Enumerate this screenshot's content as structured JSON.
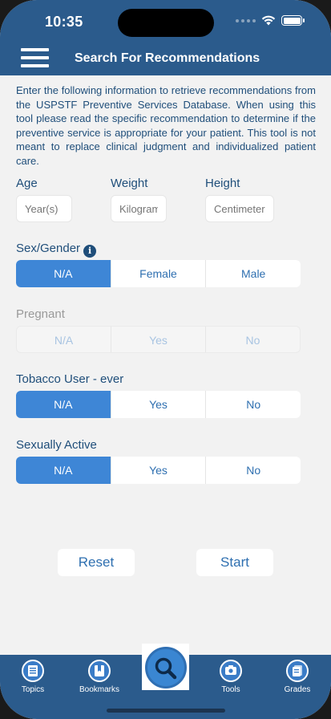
{
  "status": {
    "time": "10:35"
  },
  "header": {
    "title": "Search For Recommendations"
  },
  "intro": "Enter the following information to retrieve recommendations from the USPSTF Preventive Services Database. When using this tool please read the specific recommendation to determine if the  preventive service is appropriate for your patient. This tool is not meant to replace clinical judgment and individualized patient care.",
  "fields": {
    "age": {
      "label": "Age",
      "placeholder": "Year(s)"
    },
    "weight": {
      "label": "Weight",
      "placeholder": "Kilograms"
    },
    "height": {
      "label": "Height",
      "placeholder": "Centimeters"
    }
  },
  "sex": {
    "label": "Sex/Gender",
    "options": [
      "N/A",
      "Female",
      "Male"
    ],
    "selected": "N/A"
  },
  "pregnant": {
    "label": "Pregnant",
    "options": [
      "N/A",
      "Yes",
      "No"
    ],
    "disabled": true
  },
  "tobacco": {
    "label": "Tobacco User - ever",
    "options": [
      "N/A",
      "Yes",
      "No"
    ],
    "selected": "N/A"
  },
  "sexually_active": {
    "label": "Sexually Active",
    "options": [
      "N/A",
      "Yes",
      "No"
    ],
    "selected": "N/A"
  },
  "buttons": {
    "reset": "Reset",
    "start": "Start"
  },
  "tabs": {
    "topics": "Topics",
    "bookmarks": "Bookmarks",
    "tools": "Tools",
    "grades": "Grades"
  },
  "colors": {
    "primary": "#2b5b8c",
    "accent": "#3e86d6",
    "text": "#1f4e7a"
  }
}
